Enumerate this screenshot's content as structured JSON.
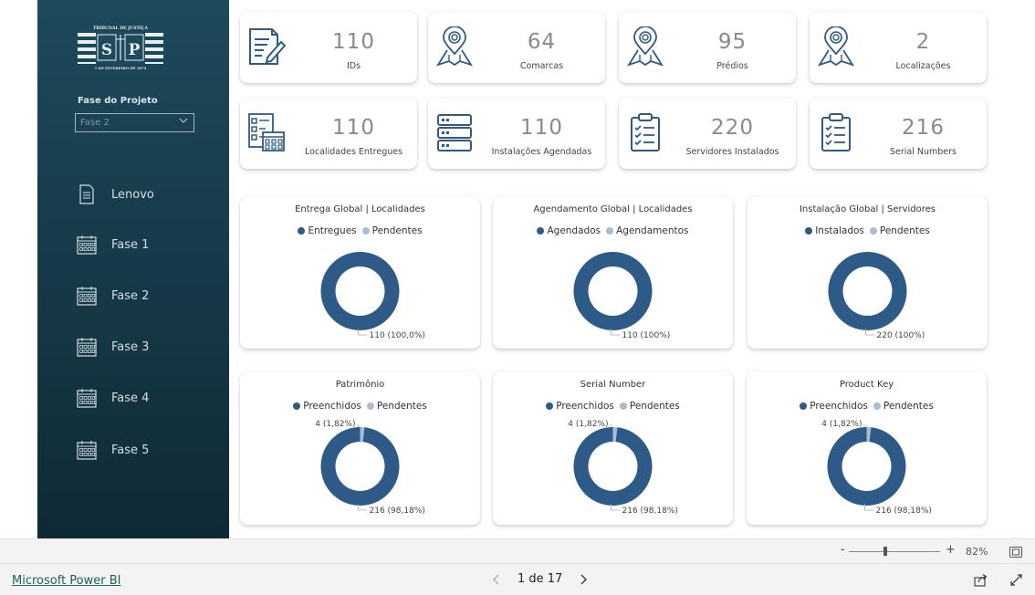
{
  "sidebar": {
    "logo_top": "TRIBUNAL DE JUSTIÇA",
    "logo_letters": [
      "S",
      "P"
    ],
    "logo_bottom": "1 DE FEVEREIRO DE 1874",
    "phase_label": "Fase do Projeto",
    "phase_value": "Fase 2",
    "items": [
      {
        "label": "Lenovo",
        "icon": "document-icon"
      },
      {
        "label": "Fase 1",
        "icon": "calendar-icon"
      },
      {
        "label": "Fase 2",
        "icon": "calendar-icon"
      },
      {
        "label": "Fase 3",
        "icon": "calendar-icon"
      },
      {
        "label": "Fase 4",
        "icon": "calendar-icon"
      },
      {
        "label": "Fase 5",
        "icon": "calendar-icon"
      }
    ]
  },
  "kpis": [
    {
      "value": "110",
      "label": "IDs",
      "icon": "form-edit-icon"
    },
    {
      "value": "64",
      "label": "Comarcas",
      "icon": "map-pin-icon"
    },
    {
      "value": "95",
      "label": "Prédios",
      "icon": "map-pin-icon"
    },
    {
      "value": "2",
      "label": "Localizações",
      "icon": "map-pin-icon"
    },
    {
      "value": "110",
      "label": "Localidades Entregues",
      "icon": "checklist-calendar-icon"
    },
    {
      "value": "110",
      "label": "Instalações Agendadas",
      "icon": "server-icon"
    },
    {
      "value": "220",
      "label": "Servidores Instalados",
      "icon": "clipboard-icon"
    },
    {
      "value": "216",
      "label": "Serial Numbers",
      "icon": "clipboard-icon"
    }
  ],
  "colors": {
    "primary": "#2e5a87",
    "secondary": "#a8bdd1",
    "sidebar": "#1d4a5c"
  },
  "charts": [
    {
      "title": "Entrega Global | Localidades",
      "legend": [
        "Entregues",
        "Pendentes"
      ],
      "label_main": "110 (100,0%)",
      "label_small": "",
      "fraction": 1.0
    },
    {
      "title": "Agendamento Global | Localidades",
      "legend": [
        "Agendados",
        "Agendamentos"
      ],
      "label_main": "110 (100%)",
      "label_small": "",
      "fraction": 1.0
    },
    {
      "title": "Instalação Global | Servidores",
      "legend": [
        "Instalados",
        "Pendentes"
      ],
      "label_main": "220 (100%)",
      "label_small": "",
      "fraction": 1.0
    },
    {
      "title": "Patrimônio",
      "legend": [
        "Preenchidos",
        "Pendentes"
      ],
      "label_main": "216 (98,18%)",
      "label_small": "4 (1,82%)",
      "fraction": 0.9818
    },
    {
      "title": "Serial Number",
      "legend": [
        "Preenchidos",
        "Pendentes"
      ],
      "label_main": "216 (98,18%)",
      "label_small": "4 (1,82%)",
      "fraction": 0.9818
    },
    {
      "title": "Product Key",
      "legend": [
        "Preenchidos",
        "Pendentes"
      ],
      "label_main": "216 (98,18%)",
      "label_small": "4 (1,82%)",
      "fraction": 0.9818
    }
  ],
  "footer": {
    "brand_link": "Microsoft Power BI",
    "page_indicator": "1 de 17",
    "zoom_minus": "-",
    "zoom_plus": "+",
    "zoom_level": "82%"
  }
}
